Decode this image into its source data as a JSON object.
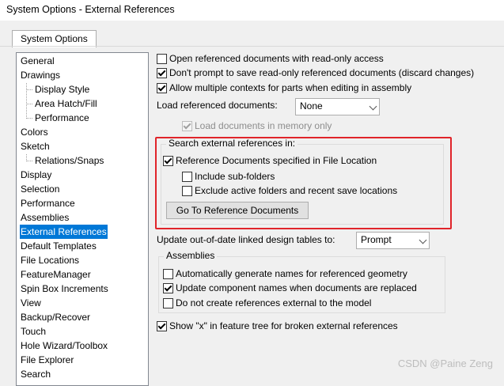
{
  "window": {
    "title": "System Options - External References"
  },
  "tabs": [
    {
      "label": "System Options"
    }
  ],
  "tree": [
    {
      "label": "General",
      "child": false
    },
    {
      "label": "Drawings",
      "child": false
    },
    {
      "label": "Display Style",
      "child": true
    },
    {
      "label": "Area Hatch/Fill",
      "child": true
    },
    {
      "label": "Performance",
      "child": true
    },
    {
      "label": "Colors",
      "child": false
    },
    {
      "label": "Sketch",
      "child": false
    },
    {
      "label": "Relations/Snaps",
      "child": true
    },
    {
      "label": "Display",
      "child": false
    },
    {
      "label": "Selection",
      "child": false
    },
    {
      "label": "Performance",
      "child": false
    },
    {
      "label": "Assemblies",
      "child": false
    },
    {
      "label": "External References",
      "child": false,
      "selected": true
    },
    {
      "label": "Default Templates",
      "child": false
    },
    {
      "label": "File Locations",
      "child": false
    },
    {
      "label": "FeatureManager",
      "child": false
    },
    {
      "label": "Spin Box Increments",
      "child": false
    },
    {
      "label": "View",
      "child": false
    },
    {
      "label": "Backup/Recover",
      "child": false
    },
    {
      "label": "Touch",
      "child": false
    },
    {
      "label": "Hole Wizard/Toolbox",
      "child": false
    },
    {
      "label": "File Explorer",
      "child": false
    },
    {
      "label": "Search",
      "child": false
    }
  ],
  "options": {
    "open_readonly": {
      "label": "Open referenced documents with read-only access",
      "checked": false
    },
    "dont_prompt": {
      "label": "Don't prompt to save read-only referenced documents (discard changes)",
      "checked": true
    },
    "allow_multiple": {
      "label": "Allow multiple contexts for parts when editing in assembly",
      "checked": true
    },
    "load_label": "Load referenced documents:",
    "load_value": "None",
    "load_in_memory": {
      "label": "Load documents in memory only",
      "checked": true,
      "disabled": true
    }
  },
  "search_group": {
    "title": "Search external references in:",
    "ref_docs": {
      "label": "Reference Documents specified in File Location",
      "checked": true
    },
    "include_sub": {
      "label": "Include sub-folders",
      "checked": false
    },
    "exclude_active": {
      "label": "Exclude active folders and recent save locations",
      "checked": false
    },
    "goto_button": "Go To Reference Documents"
  },
  "update_tables": {
    "label": "Update out-of-date linked design tables to:",
    "value": "Prompt"
  },
  "assemblies_group": {
    "title": "Assemblies",
    "auto_names": {
      "label": "Automatically generate names for referenced geometry",
      "checked": false
    },
    "update_names": {
      "label": "Update component names when documents are replaced",
      "checked": true
    },
    "no_external": {
      "label": "Do not create references external to the model",
      "checked": false
    }
  },
  "show_x": {
    "label": "Show \"x\" in feature tree for broken external references",
    "checked": true
  },
  "watermark": "CSDN @Paine Zeng",
  "colors": {
    "selection": "#0078d7",
    "highlight_box": "#e0242a"
  }
}
